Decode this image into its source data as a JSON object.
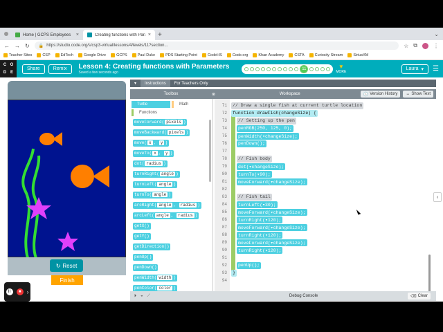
{
  "browser": {
    "tabs": [
      {
        "title": "Home | GCPS Employees",
        "active": false
      },
      {
        "title": "Creating functions with Param",
        "active": true
      }
    ],
    "url": "https://studio.code.org/s/csp3-virtual/lessons/4/levels/11?section...",
    "bookmarks": [
      "Teacher Sites",
      "CSP",
      "EdTech",
      "Google Drive",
      "GCPS",
      "Paul Duke",
      "PDS Starting Point",
      "CodeHS",
      "Code.org",
      "Khan Academy",
      "CSTA",
      "Curiosity Stream",
      "SiriusXM"
    ]
  },
  "header": {
    "logo": [
      "C",
      "O",
      "D",
      "E"
    ],
    "share": "Share",
    "remix": "Remix",
    "lesson_title": "Lesson 4: Creating functions with Parameters",
    "saved": "Saved a few seconds ago",
    "current_level": "11",
    "more": "MORE",
    "user": "Laura"
  },
  "stage": {
    "reset": "Reset",
    "finish": "Finish"
  },
  "workspace": {
    "tabs": [
      "Instructions",
      "For Teachers Only"
    ],
    "toolbox_label": "Toolbox",
    "workspace_label": "Workspace",
    "version_history": "Version History",
    "show_text": "Show Text",
    "categories": [
      "Turtle",
      "Math",
      "Functions"
    ],
    "blocks": [
      {
        "name": "moveForward",
        "params": [
          "pixels"
        ]
      },
      {
        "name": "moveBackward",
        "params": [
          "pixels"
        ]
      },
      {
        "name": "move",
        "params": [
          "x",
          "y"
        ]
      },
      {
        "name": "moveTo",
        "params": [
          "x",
          "y"
        ]
      },
      {
        "name": "dot",
        "params": [
          "radius"
        ]
      },
      {
        "name": "turnRight",
        "params": [
          "angle"
        ]
      },
      {
        "name": "turnLeft",
        "params": [
          "angle"
        ]
      },
      {
        "name": "turnTo",
        "params": [
          "angle"
        ]
      },
      {
        "name": "arcRight",
        "params": [
          "angle",
          "radius"
        ]
      },
      {
        "name": "arcLeft",
        "params": [
          "angle",
          "radius"
        ]
      },
      {
        "name": "getX",
        "params": []
      },
      {
        "name": "getY",
        "params": []
      },
      {
        "name": "getDirection",
        "params": []
      },
      {
        "name": "penUp",
        "params": []
      },
      {
        "name": "penDown",
        "params": []
      },
      {
        "name": "penWidth",
        "params": [
          "width"
        ]
      },
      {
        "name": "penColor",
        "params": [
          "color"
        ]
      }
    ]
  },
  "editor": {
    "lines": [
      {
        "n": "71",
        "indent": 0,
        "kind": "cmt",
        "text": "// Draw a single fish at current turtle location"
      },
      {
        "n": "72",
        "indent": 0,
        "kind": "fn",
        "text": "function drawFish(changeSize) {"
      },
      {
        "n": "73",
        "indent": 1,
        "kind": "cmt",
        "text": "// Setting up the pen"
      },
      {
        "n": "74",
        "indent": 1,
        "kind": "turtle",
        "text": "penRGB(250, 125, 0);"
      },
      {
        "n": "75",
        "indent": 1,
        "kind": "turtle",
        "text": "penWidth(▾changeSize);"
      },
      {
        "n": "76",
        "indent": 1,
        "kind": "turtle",
        "text": "penDown();"
      },
      {
        "n": "77",
        "indent": 1,
        "kind": "blank",
        "text": ""
      },
      {
        "n": "78",
        "indent": 1,
        "kind": "cmt",
        "text": "// Fish body"
      },
      {
        "n": "79",
        "indent": 1,
        "kind": "turtle",
        "text": "dot(▾changeSize);"
      },
      {
        "n": "80",
        "indent": 1,
        "kind": "turtle",
        "text": "turnTo(▾90);"
      },
      {
        "n": "81",
        "indent": 1,
        "kind": "turtle",
        "text": "moveForward(▾changeSize);"
      },
      {
        "n": "82",
        "indent": 1,
        "kind": "blank",
        "text": ""
      },
      {
        "n": "83",
        "indent": 1,
        "kind": "cmt",
        "text": "// Fish tail"
      },
      {
        "n": "84",
        "indent": 1,
        "kind": "turtle",
        "text": "turnLeft(▾30);"
      },
      {
        "n": "85",
        "indent": 1,
        "kind": "turtle",
        "text": "moveForward(▾changeSize);"
      },
      {
        "n": "86",
        "indent": 1,
        "kind": "turtle",
        "text": "turnRight(▾120);"
      },
      {
        "n": "87",
        "indent": 1,
        "kind": "turtle",
        "text": "moveForward(▾changeSize);"
      },
      {
        "n": "88",
        "indent": 1,
        "kind": "turtle",
        "text": "turnRight(▾120);"
      },
      {
        "n": "89",
        "indent": 1,
        "kind": "turtle",
        "text": "moveForward(▾changeSize);"
      },
      {
        "n": "90",
        "indent": 1,
        "kind": "turtle",
        "text": "turnRight(▾120);"
      },
      {
        "n": "91",
        "indent": 1,
        "kind": "blank",
        "text": ""
      },
      {
        "n": "92",
        "indent": 1,
        "kind": "turtle",
        "text": "penUp();"
      },
      {
        "n": "93",
        "indent": 0,
        "kind": "fn",
        "text": "}"
      },
      {
        "n": "94",
        "indent": 0,
        "kind": "blank",
        "text": ""
      }
    ]
  },
  "debug": {
    "title": "Debug Console",
    "clear": "Clear"
  },
  "colors": {
    "brand": "#00adbc",
    "canvas": "#00138f",
    "fish": "#ff7f00",
    "star": "#e040fb",
    "seaweed": "#33dd33"
  }
}
